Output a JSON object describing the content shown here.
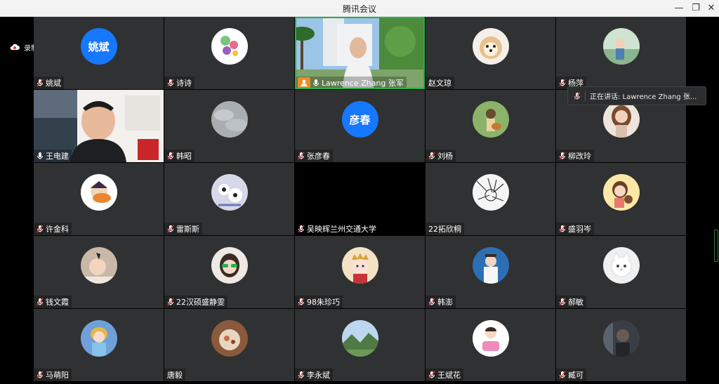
{
  "window": {
    "title": "腾讯会议",
    "minimize_icon": "minimize-icon",
    "restore_icon": "restore-icon",
    "close_icon": "close-icon"
  },
  "recording": {
    "label": "录制中",
    "icon": "cloud-record-icon"
  },
  "speaking": {
    "label": "正在讲话: Lawrence Zhang 张..."
  },
  "colors": {
    "accent": "#1677ff",
    "tile_bg": "#303132",
    "speaking_border": "#25b04e",
    "muted_red": "#e23b3b"
  },
  "participants": [
    {
      "name": "姚斌",
      "avatar_text": "姚斌",
      "mic": "muted"
    },
    {
      "name": "诗诗",
      "avatar": "cartoon-flowers-avatar",
      "mic": "muted"
    },
    {
      "name": "Lawrence Zhang 张军",
      "video": "man-garden-video",
      "mic": "on",
      "speaking": true
    },
    {
      "name": "赵文琼",
      "avatar": "pomeranian-dog-avatar",
      "mic": "none"
    },
    {
      "name": "杨萍",
      "avatar": "girl-photo-avatar",
      "mic": "muted"
    },
    {
      "name": "王电建",
      "video": "man-presentation-video",
      "mic": "on"
    },
    {
      "name": "韩昭",
      "avatar": "grey-sky-avatar",
      "mic": "muted"
    },
    {
      "name": "张彦春",
      "avatar_text": "彦春",
      "mic": "muted"
    },
    {
      "name": "刘杨",
      "avatar": "guitar-cartoon-avatar",
      "mic": "muted"
    },
    {
      "name": "柳改玲",
      "avatar": "woman-portrait-avatar",
      "mic": "muted"
    },
    {
      "name": "许金科",
      "avatar": "masked-cartoon-avatar",
      "mic": "muted"
    },
    {
      "name": "雷斯斯",
      "avatar": "cute-animals-avatar",
      "mic": "muted"
    },
    {
      "name": "吴映辉兰州交通大学",
      "black": true,
      "mic": "muted"
    },
    {
      "name": "22拓欣桐",
      "avatar": "manga-sketch-avatar",
      "mic": "none"
    },
    {
      "name": "盛羽岑",
      "avatar": "cartoon-girl-avatar",
      "mic": "muted"
    },
    {
      "name": "钱文霞",
      "avatar": "baby-photo-avatar",
      "mic": "muted"
    },
    {
      "name": "22汉硕盛静雯",
      "avatar": "green-glasses-avatar",
      "mic": "muted"
    },
    {
      "name": "98朱珍巧",
      "avatar": "princess-cartoon-avatar",
      "mic": "muted"
    },
    {
      "name": "韩澎",
      "avatar": "boy-in-shirt-avatar",
      "mic": "muted"
    },
    {
      "name": "郝敏",
      "avatar": "white-cat-avatar",
      "mic": "muted"
    },
    {
      "name": "马萌阳",
      "avatar": "cinderella-cartoon-avatar",
      "mic": "muted"
    },
    {
      "name": "唐毅",
      "avatar": "food-photo-avatar",
      "mic": "none"
    },
    {
      "name": "李永斌",
      "avatar": "mountain-landscape-avatar",
      "mic": "muted"
    },
    {
      "name": "王斌花",
      "avatar": "pink-cartoon-avatar",
      "mic": "muted"
    },
    {
      "name": "臧可",
      "avatar": "dark-portrait-avatar",
      "mic": "muted"
    }
  ]
}
